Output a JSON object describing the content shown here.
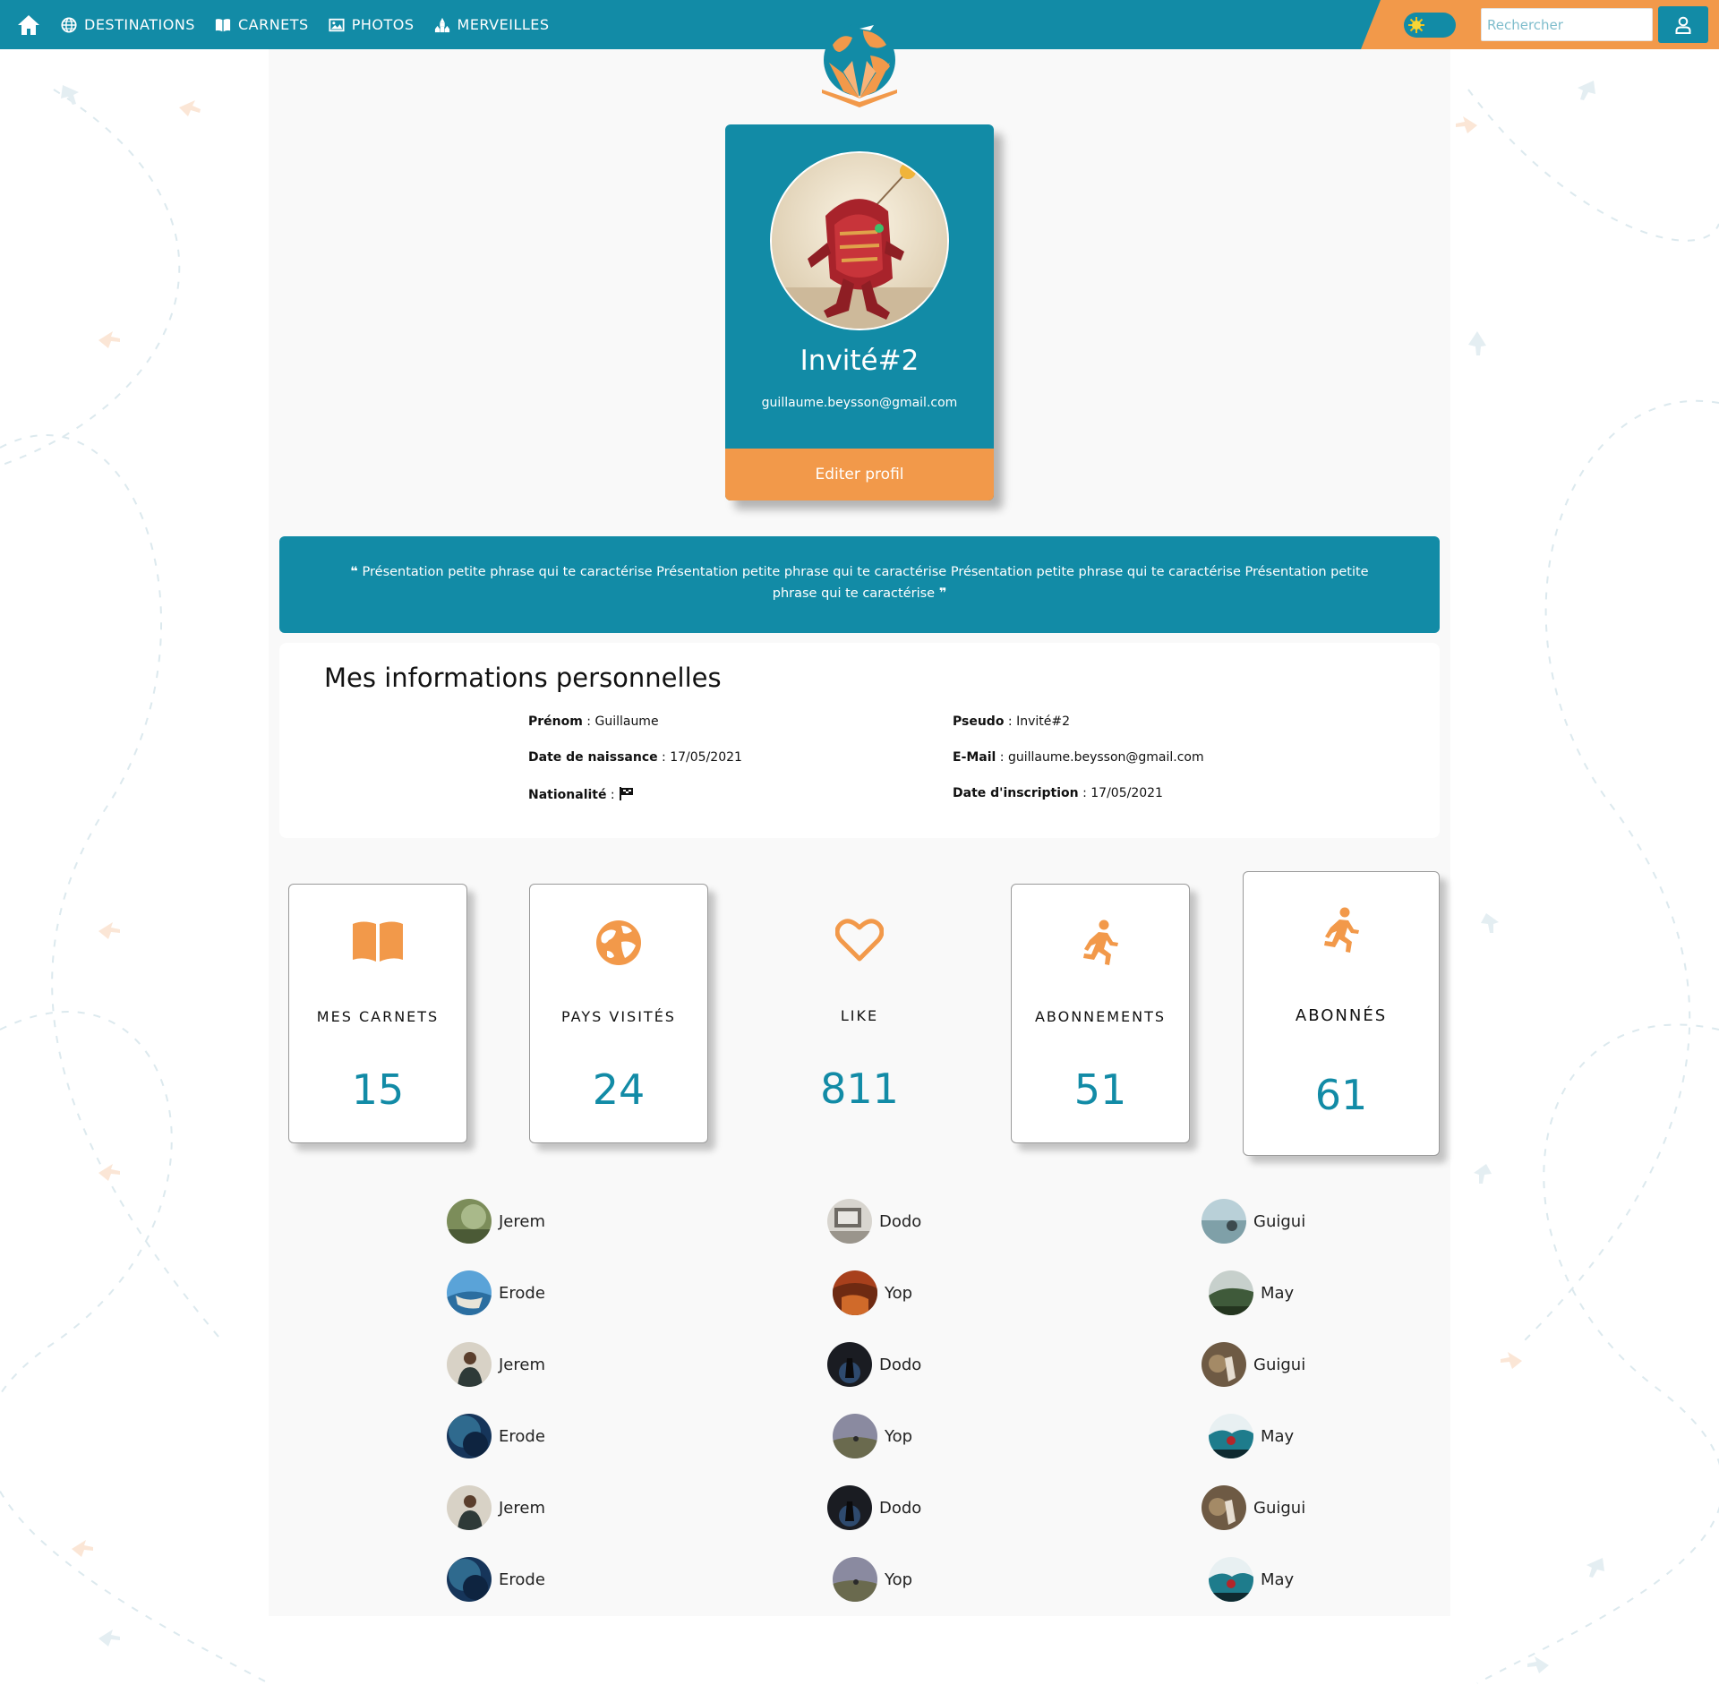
{
  "colors": {
    "primary": "#128ba6",
    "accent": "#f2994a",
    "page_bg": "#f9f9f9"
  },
  "nav": {
    "home_icon": "home-icon",
    "links": [
      {
        "label": "DESTINATIONS",
        "icon": "globe-icon"
      },
      {
        "label": "CARNETS",
        "icon": "book-icon"
      },
      {
        "label": "PHOTOS",
        "icon": "image-icon"
      },
      {
        "label": "MERVEILLES",
        "icon": "monument-icon"
      }
    ],
    "theme_toggle_icon": "sun-icon",
    "search_placeholder": "Rechercher",
    "user_icon": "user-icon"
  },
  "profile": {
    "name": "Invité#2",
    "email": "guillaume.beysson@gmail.com",
    "edit_label": "Editer profil"
  },
  "presentation": {
    "text": "Présentation petite phrase qui te caractérise Présentation petite phrase qui te caractérise Présentation petite phrase qui te caractérise Présentation petite phrase qui te caractérise"
  },
  "info": {
    "title": "Mes informations personnelles",
    "left": [
      {
        "label": "Prénom",
        "value": "Guillaume"
      },
      {
        "label": "Date de naissance",
        "value": "17/05/2021"
      },
      {
        "label": "Nationalité",
        "value": ""
      }
    ],
    "right": [
      {
        "label": "Pseudo",
        "value": "Invité#2"
      },
      {
        "label": "E-Mail",
        "value": "guillaume.beysson@gmail.com"
      },
      {
        "label": "Date d'inscription",
        "value": "17/05/2021"
      }
    ]
  },
  "stats": [
    {
      "label": "MES CARNETS",
      "value": "15",
      "icon": "book-open-icon"
    },
    {
      "label": "PAYS VISITÉS",
      "value": "24",
      "icon": "earth-icon"
    },
    {
      "label": "LIKE",
      "value": "811",
      "icon": "heart-icon"
    },
    {
      "label": "ABONNEMENTS",
      "value": "51",
      "icon": "running-icon"
    },
    {
      "label": "ABONNÉS",
      "value": "61",
      "icon": "running-icon"
    }
  ],
  "people": [
    [
      "Jerem",
      "Dodo",
      "Guigui"
    ],
    [
      "Erode",
      "Yop",
      "May"
    ],
    [
      "Jerem",
      "Dodo",
      "Guigui"
    ],
    [
      "Erode",
      "Yop",
      "May"
    ],
    [
      "Jerem",
      "Dodo",
      "Guigui"
    ],
    [
      "Erode",
      "Yop",
      "May"
    ]
  ]
}
